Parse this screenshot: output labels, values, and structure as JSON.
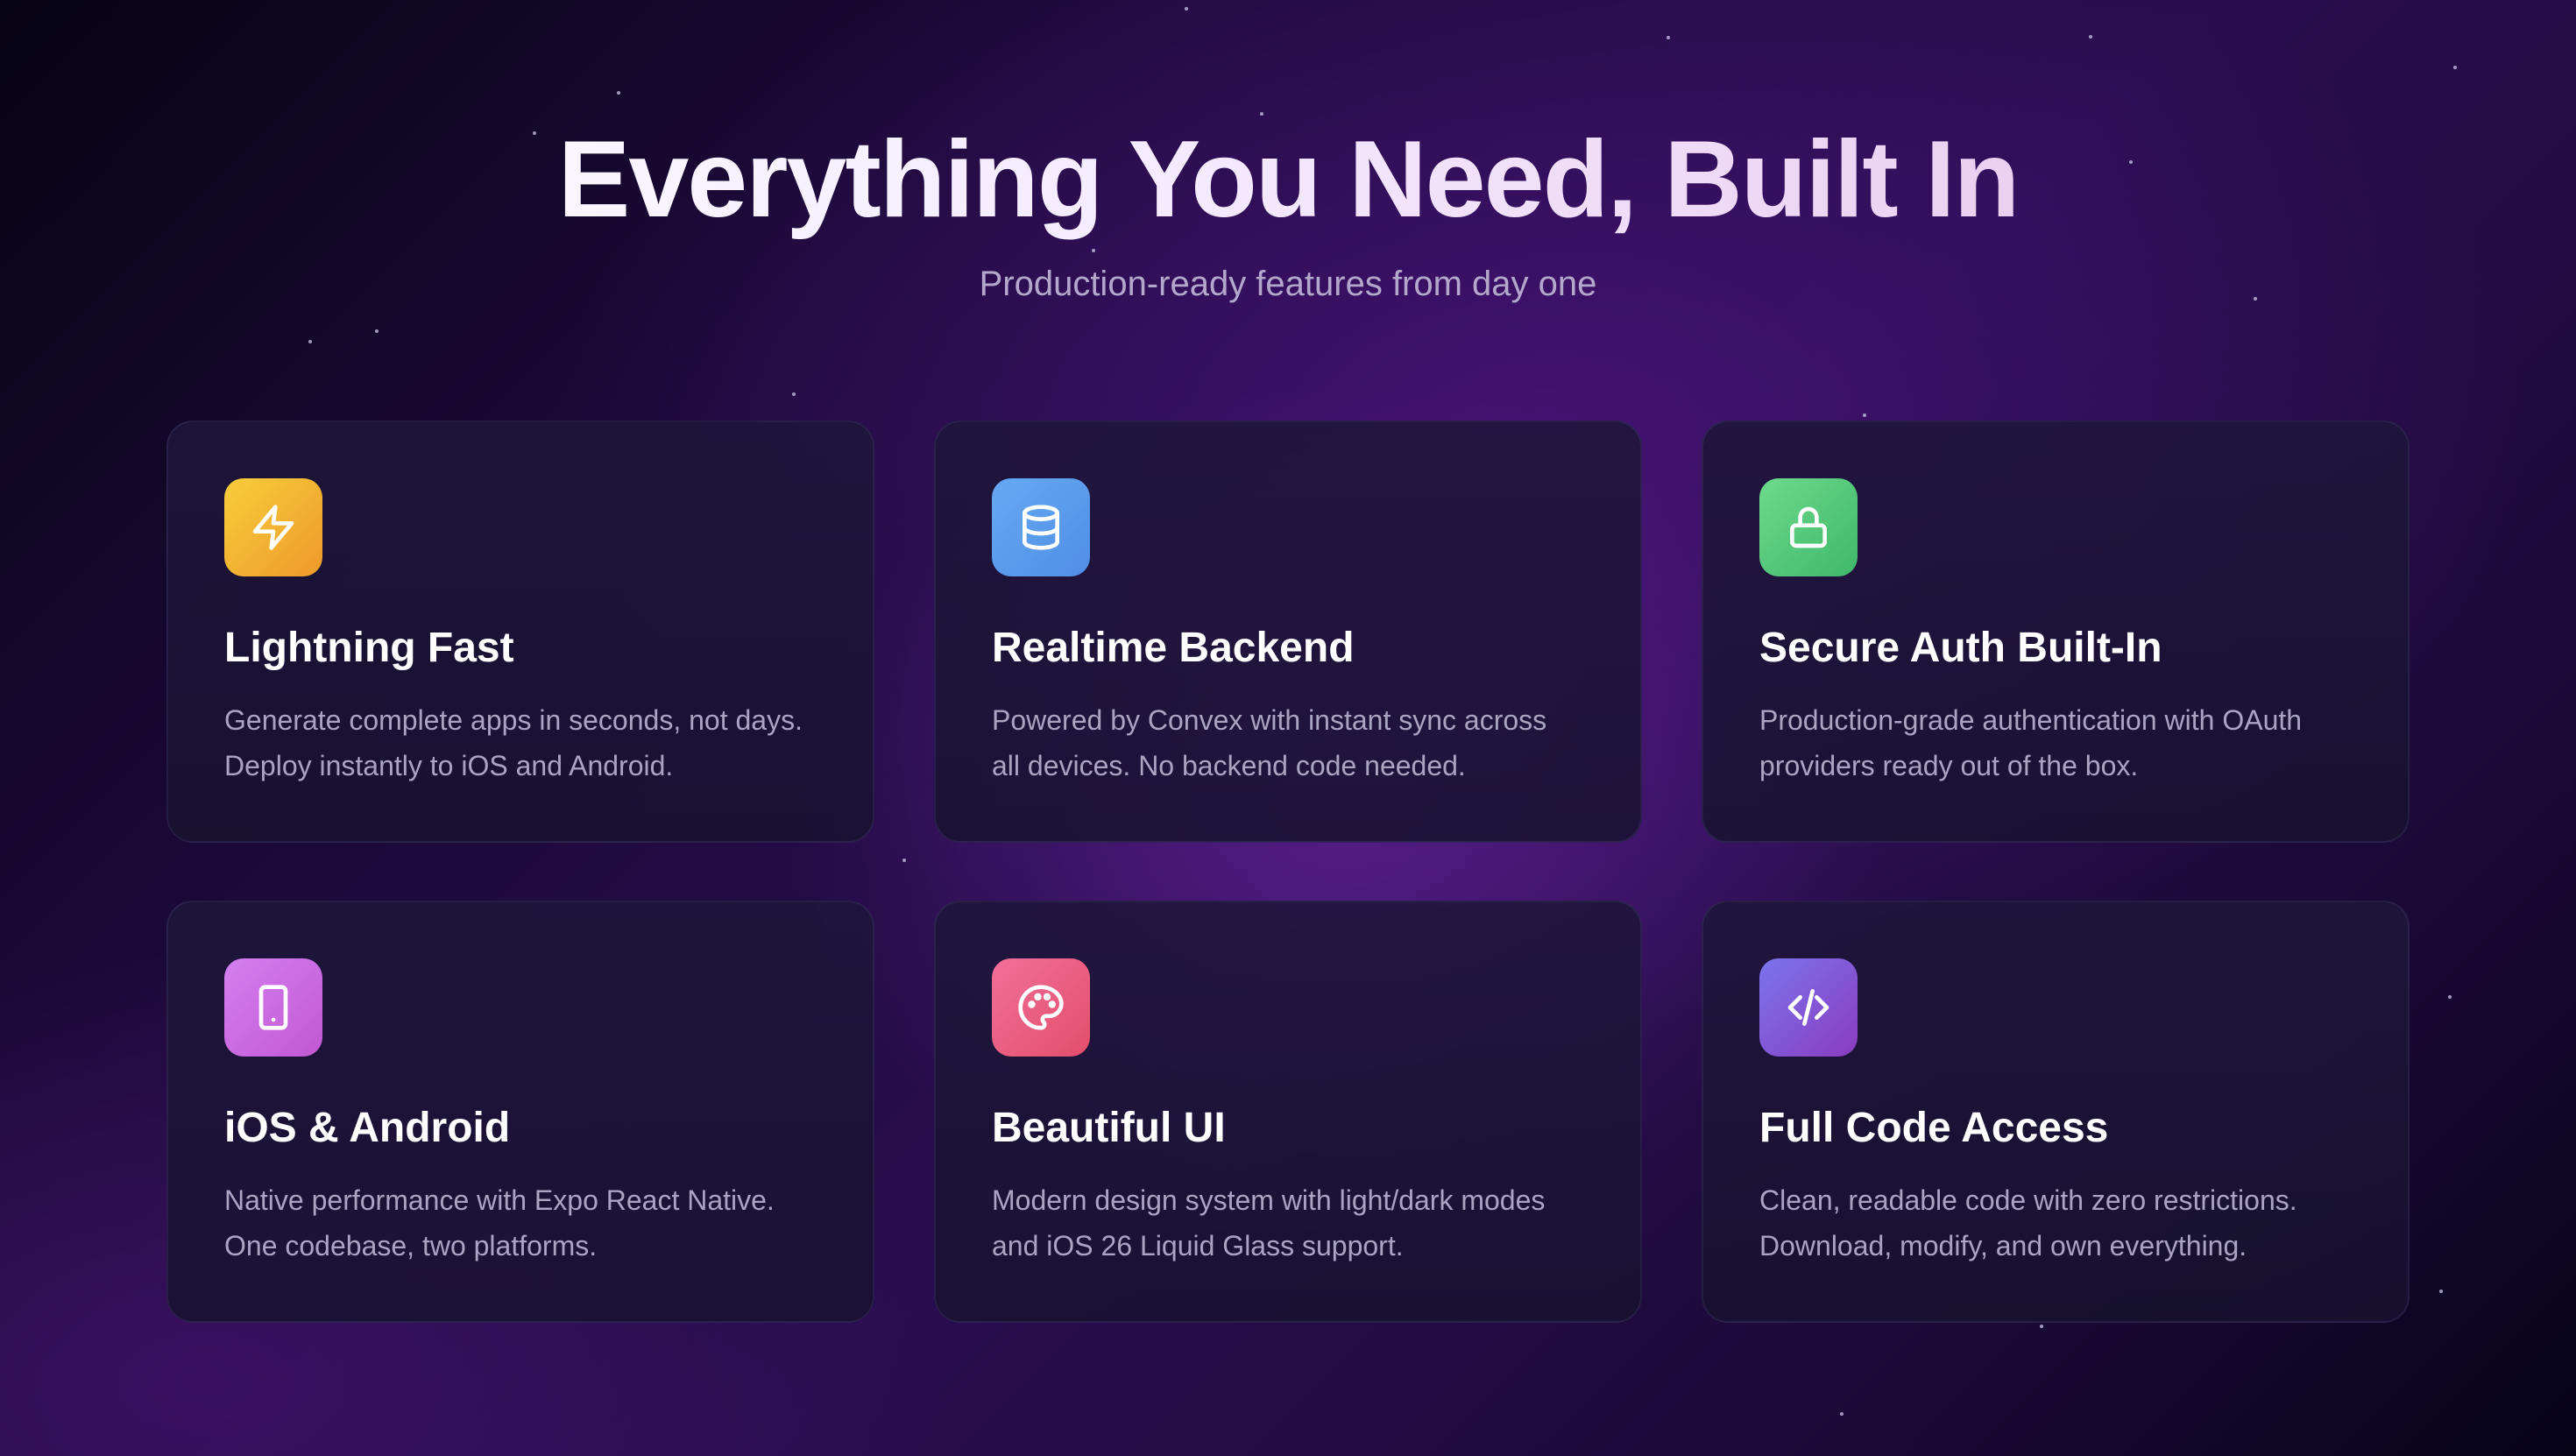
{
  "header": {
    "title": "Everything You Need, Built In",
    "subtitle": "Production-ready features from day one"
  },
  "features": [
    {
      "title": "Lightning Fast",
      "description": "Generate complete apps in seconds, not days.\nDeploy instantly to iOS and Android.",
      "icon": "lightning-icon",
      "colors": [
        "#f8cd3c",
        "#ee9a2a"
      ]
    },
    {
      "title": "Realtime Backend",
      "description": "Powered by Convex with instant sync across\nall devices. No backend code needed.",
      "icon": "database-icon",
      "colors": [
        "#67aaf2",
        "#4f8ee6"
      ]
    },
    {
      "title": "Secure Auth Built-In",
      "description": "Production-grade authentication with OAuth\nproviders ready out of the box.",
      "icon": "lock-icon",
      "colors": [
        "#6ed98c",
        "#3fb86a"
      ]
    },
    {
      "title": "iOS & Android",
      "description": "Native performance with Expo React Native.\nOne codebase, two platforms.",
      "icon": "smartphone-icon",
      "colors": [
        "#d480f0",
        "#c257d4"
      ]
    },
    {
      "title": "Beautiful UI",
      "description": "Modern design system with light/dark modes\nand iOS 26 Liquid Glass support.",
      "icon": "palette-icon",
      "colors": [
        "#f2709a",
        "#e24e6b"
      ]
    },
    {
      "title": "Full Code Access",
      "description": "Clean, readable code with zero restrictions.\nDownload, modify, and own everything.",
      "icon": "code-icon",
      "colors": [
        "#7b74ee",
        "#8a3cc0"
      ]
    }
  ]
}
